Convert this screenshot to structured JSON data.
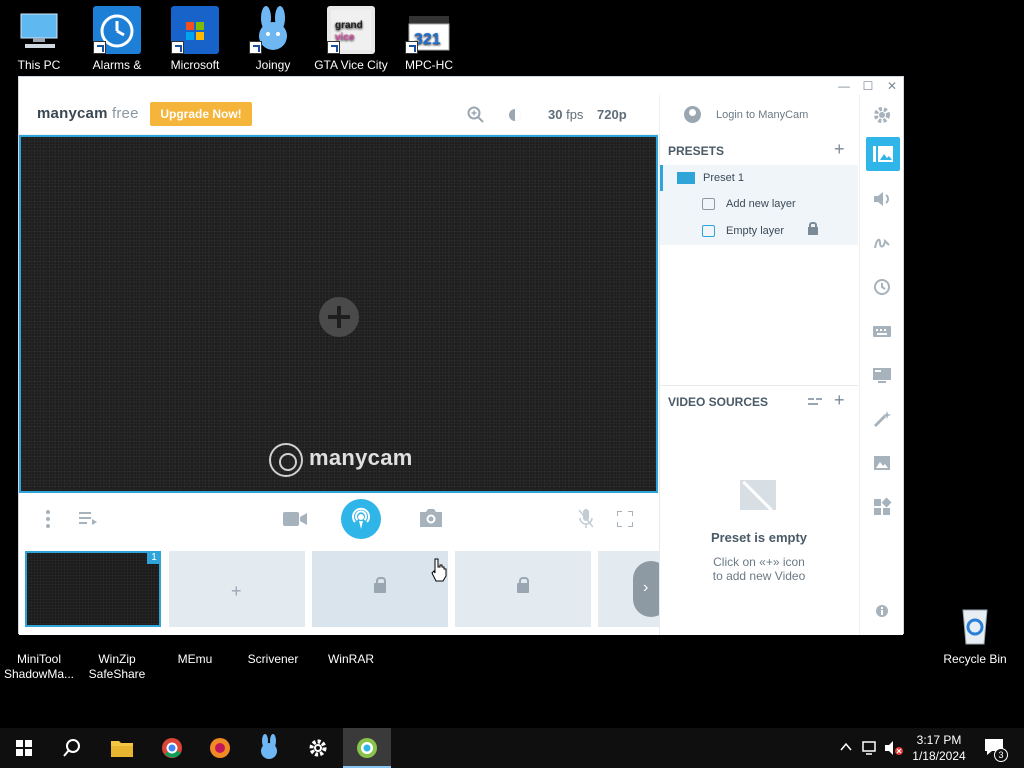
{
  "desktop": {
    "icons_top": [
      {
        "label": "This PC",
        "icon": "this-pc-icon"
      },
      {
        "label": "Alarms &",
        "icon": "alarm-clock-icon"
      },
      {
        "label": "Microsoft",
        "icon": "microsoft-store-icon"
      },
      {
        "label": "Joingy",
        "icon": "joingy-bunny-icon"
      },
      {
        "label": "GTA Vice City",
        "icon": "gta-vice-city-icon"
      },
      {
        "label": "MPC-HC",
        "icon": "mpc-hc-icon"
      }
    ],
    "icons_bottom": [
      {
        "label": "MiniTool ShadowMa...",
        "icon": "minitool-icon"
      },
      {
        "label": "WinZip SafeShare",
        "icon": "winzip-icon"
      },
      {
        "label": "MEmu",
        "icon": "memu-icon"
      },
      {
        "label": "Scrivener",
        "icon": "scrivener-icon"
      },
      {
        "label": "WinRAR",
        "icon": "winrar-icon"
      }
    ],
    "recycle_bin": "Recycle Bin"
  },
  "window": {
    "logo_brand": "manycam",
    "logo_edition": " free",
    "upgrade_label": "Upgrade Now!",
    "fps_value": "30",
    "fps_unit": " fps",
    "resolution": "720p",
    "login_label": "Login to ManyCam",
    "watermark": "manycam",
    "thumb_badge": "1"
  },
  "panel": {
    "presets_title": "PRESETS",
    "preset_name": "Preset 1",
    "add_layer": "Add new layer",
    "empty_layer": "Empty layer",
    "video_sources_title": "VIDEO SOURCES",
    "empty_title": "Preset is empty",
    "empty_sub_1": "Click on «+» icon",
    "empty_sub_2": "to add new Video"
  },
  "taskbar": {
    "time": "3:17 PM",
    "date": "1/18/2024",
    "notif_count": "3"
  },
  "colors": {
    "accent": "#2fb5e8",
    "upgrade": "#f5b43a"
  }
}
